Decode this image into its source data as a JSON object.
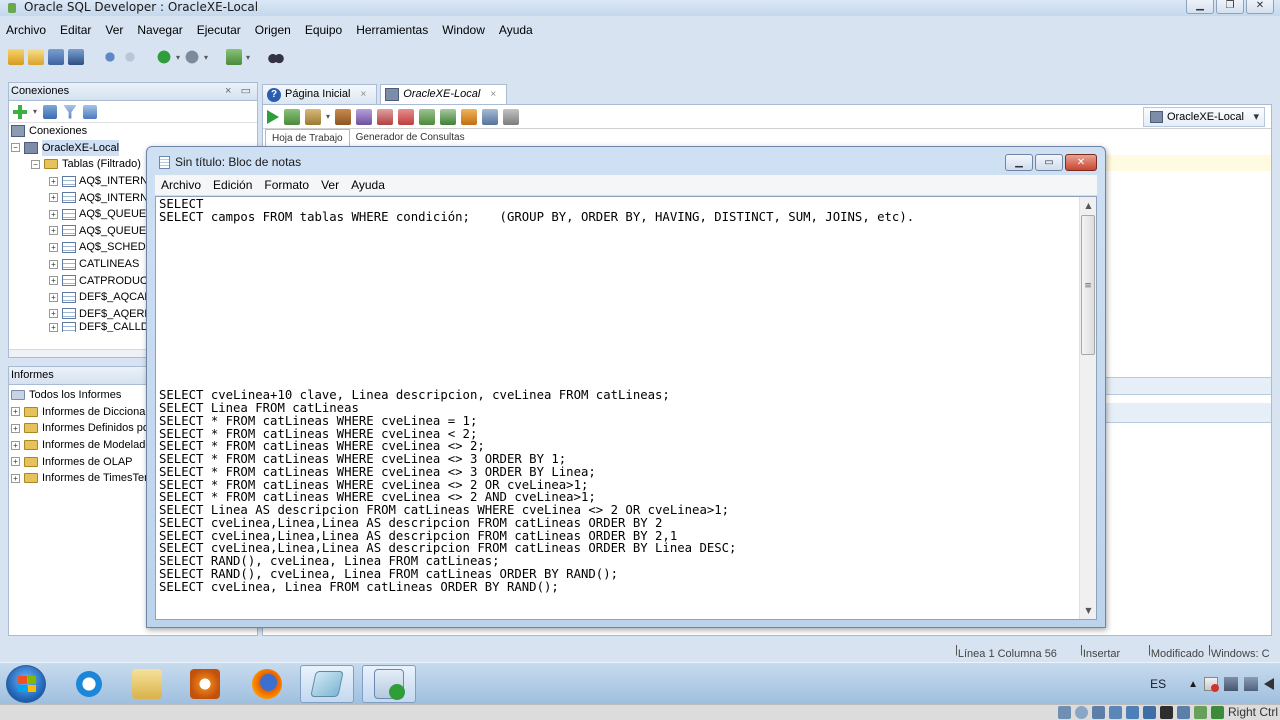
{
  "sqldev": {
    "title": "Oracle SQL Developer : OracleXE-Local",
    "menu": [
      "Archivo",
      "Editar",
      "Ver",
      "Navegar",
      "Ejecutar",
      "Origen",
      "Equipo",
      "Herramientas",
      "Window",
      "Ayuda"
    ],
    "connections_panel": {
      "title": "Conexiones",
      "tree": [
        {
          "label": "Conexiones",
          "icon": "connections-icon"
        },
        {
          "label": "OracleXE-Local",
          "icon": "database-icon"
        },
        {
          "label": "Tablas (Filtrado)",
          "icon": "folder-icon"
        },
        {
          "label": "AQ$_INTERN",
          "icon": "table-icon"
        },
        {
          "label": "AQ$_INTERN",
          "icon": "table-icon"
        },
        {
          "label": "AQ$_QUEUE_",
          "icon": "table-icon"
        },
        {
          "label": "AQ$_QUEUES",
          "icon": "table-icon"
        },
        {
          "label": "AQ$_SCHEDU",
          "icon": "table-icon"
        },
        {
          "label": "CATLINEAS",
          "icon": "table-icon"
        },
        {
          "label": "CATPRODUCT",
          "icon": "table-icon"
        },
        {
          "label": "DEF$_AQCAL",
          "icon": "table-icon"
        },
        {
          "label": "DEF$_AQERR",
          "icon": "table-icon"
        },
        {
          "label": "DEF$_CALLD",
          "icon": "table-icon"
        }
      ]
    },
    "reports_panel": {
      "title": "Informes",
      "tree": [
        {
          "label": "Todos los Informes"
        },
        {
          "label": "Informes de Diccionar"
        },
        {
          "label": "Informes Definidos po"
        },
        {
          "label": "Informes de Modelade"
        },
        {
          "label": "Informes de OLAP"
        },
        {
          "label": "Informes de TimesTer"
        }
      ]
    },
    "editor_tabs": [
      {
        "label": "Página Inicial",
        "icon": "help-icon"
      },
      {
        "label": "OracleXE-Local",
        "icon": "sql-icon"
      }
    ],
    "sub_tabs": [
      "Hoja de Trabajo",
      "Generador de Consultas"
    ],
    "connection_selector": "OracleXE-Local",
    "status": {
      "position": "Línea 1 Columna 56",
      "mode": "Insertar",
      "modified": "Modificado",
      "eol": "Windows: C"
    }
  },
  "notepad": {
    "title": "Sin título: Bloc de notas",
    "menu": [
      "Archivo",
      "Edición",
      "Formato",
      "Ver",
      "Ayuda"
    ],
    "lines": [
      "SELECT",
      "SELECT campos FROM tablas WHERE condición;    (GROUP BY, ORDER BY, HAVING, DISTINCT, SUM, JOINS, etc).",
      "",
      "",
      "",
      "",
      "",
      "",
      "",
      "",
      "",
      "",
      "",
      "",
      "",
      "SELECT cveLinea+10 clave, Linea descripcion, cveLinea FROM catLineas;",
      "SELECT Linea FROM catLineas",
      "SELECT * FROM catLineas WHERE cveLinea = 1;",
      "SELECT * FROM catLineas WHERE cveLinea < 2;",
      "SELECT * FROM catLineas WHERE cveLinea <> 2;",
      "SELECT * FROM catLineas WHERE cveLinea <> 3 ORDER BY 1;",
      "SELECT * FROM catLineas WHERE cveLinea <> 3 ORDER BY Linea;",
      "SELECT * FROM catLineas WHERE cveLinea <> 2 OR cveLinea>1;",
      "SELECT * FROM catLineas WHERE cveLinea <> 2 AND cveLinea>1;",
      "SELECT Linea AS descripcion FROM catLineas WHERE cveLinea <> 2 OR cveLinea>1;",
      "SELECT cveLinea,Linea,Linea AS descripcion FROM catLineas ORDER BY 2",
      "SELECT cveLinea,Linea,Linea AS descripcion FROM catLineas ORDER BY 2,1",
      "SELECT cveLinea,Linea,Linea AS descripcion FROM catLineas ORDER BY Linea DESC;",
      "SELECT RAND(), cveLinea, Linea FROM catLineas;",
      "SELECT RAND(), cveLinea, Linea FROM catLineas ORDER BY RAND();",
      "SELECT cveLinea, Linea FROM catLineas ORDER BY RAND();"
    ]
  },
  "taskbar": {
    "language": "ES",
    "apps": [
      "internet-explorer-icon",
      "explorer-icon",
      "media-player-icon",
      "firefox-icon",
      "notepad-icon",
      "sqldeveloper-icon"
    ]
  },
  "vm_bar": {
    "host_key": "Right Ctrl"
  }
}
